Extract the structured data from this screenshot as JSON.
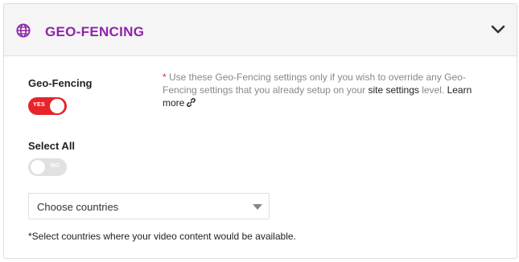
{
  "header": {
    "title": "GEO-FENCING",
    "title_color": "#8e24aa",
    "icon": "globe-icon",
    "collapse_icon": "chevron-down-icon"
  },
  "geo_fencing": {
    "label": "Geo-Fencing",
    "toggle_state": "on",
    "toggle_text": "YES",
    "toggle_color": "#e8242b"
  },
  "select_all": {
    "label": "Select All",
    "toggle_state": "off",
    "toggle_text": "NO"
  },
  "note": {
    "asterisk": "*",
    "text_before": " Use these Geo-Fencing settings only if you wish to override any Geo-Fencing settings that you already setup on your ",
    "site_settings_link": "site settings",
    "text_after": " level. ",
    "learn_more_link": "Learn more",
    "link_icon": "external-link-icon"
  },
  "countries": {
    "placeholder": "Choose countries",
    "caret_icon": "caret-down-icon"
  },
  "helper_text": "*Select countries where your video content would be available."
}
